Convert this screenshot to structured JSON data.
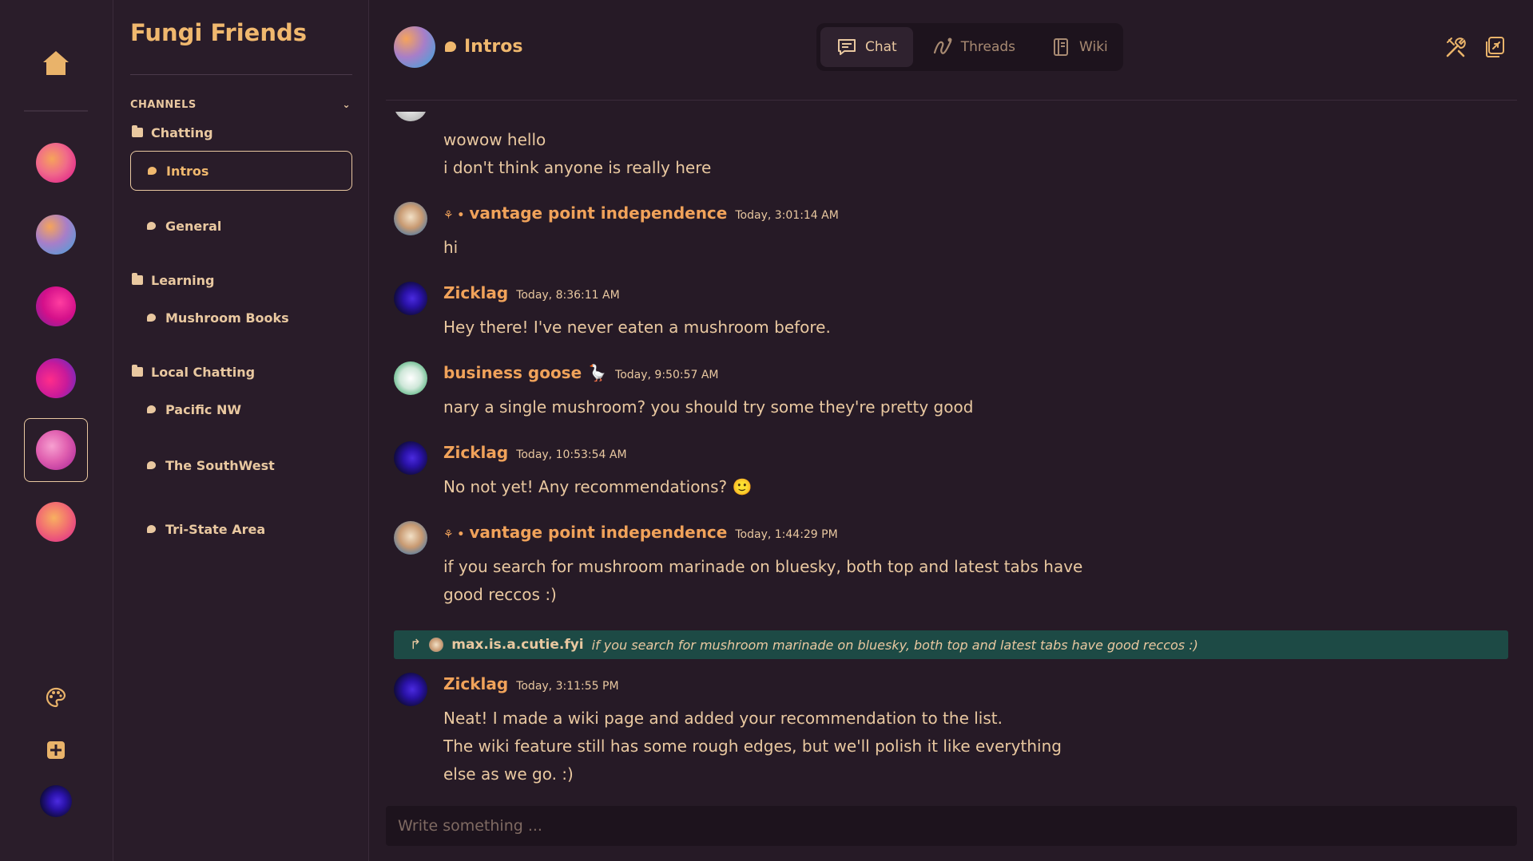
{
  "app": {
    "community_name": "Fungi Friends"
  },
  "sidebar": {
    "channels_header": "CHANNELS",
    "folders": [
      {
        "name": "Chatting",
        "channels": [
          "Intros",
          "General"
        ]
      },
      {
        "name": "Learning",
        "channels": [
          "Mushroom Books"
        ]
      },
      {
        "name": "Local Chatting",
        "channels": [
          "Pacific NW",
          "The SouthWest",
          "Tri-State Area"
        ]
      }
    ],
    "selected_channel": "Intros"
  },
  "header": {
    "channel_title": "Intros",
    "tabs": [
      {
        "label": "Chat",
        "icon": "chat-icon",
        "active": true
      },
      {
        "label": "Threads",
        "icon": "threads-icon",
        "active": false
      },
      {
        "label": "Wiki",
        "icon": "wiki-icon",
        "active": false
      }
    ]
  },
  "messages": {
    "partial_lines": [
      "wowow hello",
      "i don't think anyone is really here"
    ],
    "items": [
      {
        "author_prefix": "⚘ •",
        "author": "vantage point independence",
        "timestamp": "Today, 3:01:14 AM",
        "lines": [
          "hi"
        ]
      },
      {
        "author_prefix": "",
        "author": "Zicklag",
        "timestamp": "Today, 8:36:11 AM",
        "lines": [
          "Hey there! I've never eaten a mushroom before."
        ]
      },
      {
        "author_prefix": "",
        "author": "business goose 🪿",
        "timestamp": "Today, 9:50:57 AM",
        "lines": [
          "nary a single mushroom? you should try some they're pretty good"
        ]
      },
      {
        "author_prefix": "",
        "author": "Zicklag",
        "timestamp": "Today, 10:53:54 AM",
        "lines": [
          "No not yet! Any recommendations? 🙂"
        ]
      },
      {
        "author_prefix": "⚘ •",
        "author": "vantage point independence",
        "timestamp": "Today, 1:44:29 PM",
        "lines": [
          "if you search for mushroom marinade on bluesky, both top and latest tabs have",
          "good reccos :)"
        ]
      },
      {
        "author_prefix": "",
        "author": "Zicklag",
        "timestamp": "Today, 3:11:55 PM",
        "lines": [
          "Neat! I made a wiki page and added your recommendation to the list.",
          "The wiki feature still has some rough edges, but we'll polish it like everything",
          "else as we go. :)"
        ]
      }
    ],
    "reply": {
      "arrow": "↱",
      "user": "max.is.a.cutie.fyi",
      "text": "if you search for mushroom marinade on bluesky, both top and latest tabs have good reccos :)"
    }
  },
  "composer": {
    "placeholder": "Write something ..."
  },
  "colors": {
    "background": "#261a26",
    "accent": "#f0a25a",
    "text": "#e9c8a0",
    "reply_bg": "#1d4a45"
  }
}
